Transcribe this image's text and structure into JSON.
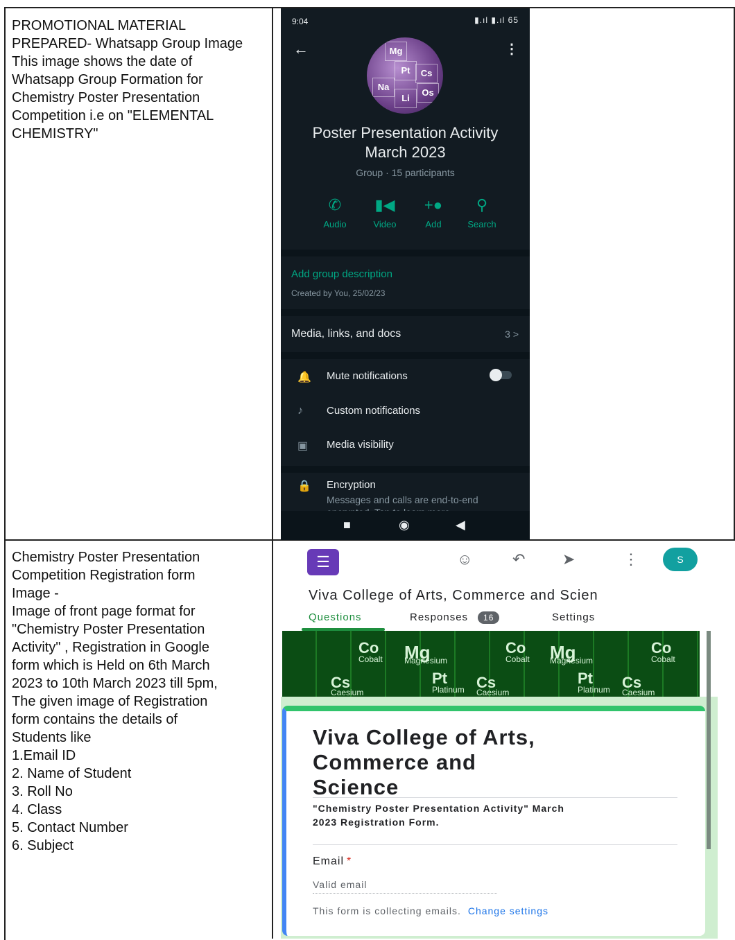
{
  "rows": [
    {
      "description": "PROMOTIONAL MATERIAL\nPREPARED- Whatsapp Group Image\nThis image shows the date of\nWhatsapp Group Formation for\nChemistry Poster Presentation\nCompetition i.e on \"ELEMENTAL\nCHEMISTRY\""
    },
    {
      "description": "Chemistry Poster Presentation\nCompetition Registration form\nImage -\nImage of front page format for\n\"Chemistry Poster Presentation\nActivity\" , Registration in Google\nform which is Held on 6th March\n2023 to 10th March 2023 till 5pm,\nThe given image of Registration\nform contains the details of\nStudents like\n1.Email ID\n2. Name of Student\n3. Roll No\n4. Class\n5. Contact Number\n6. Subject"
    }
  ],
  "whatsapp": {
    "status_time": "9:04",
    "status_right": "▮.ıl ▮.ıl 65",
    "avatar_tiles": [
      "Mg",
      "Pt",
      "Cs",
      "Na",
      "Li",
      "Os"
    ],
    "group_name": "Poster Presentation Activity\nMarch 2023",
    "group_meta": "Group · 15 participants",
    "actions": [
      {
        "label": "Audio",
        "icon": "phone-icon"
      },
      {
        "label": "Video",
        "icon": "video-icon"
      },
      {
        "label": "Add",
        "icon": "add-person-icon"
      },
      {
        "label": "Search",
        "icon": "search-icon"
      }
    ],
    "add_description": "Add group description",
    "created_by": "Created by You, 25/02/23",
    "media_label": "Media, links, and docs",
    "media_count": "3 >",
    "settings": [
      {
        "label": "Mute notifications",
        "icon": "bell-icon"
      },
      {
        "label": "Custom notifications",
        "icon": "music-note-icon"
      },
      {
        "label": "Media visibility",
        "icon": "image-icon"
      },
      {
        "label": "Encryption",
        "icon": "lock-icon"
      }
    ],
    "encryption_sub": "Messages and calls are end-to-end\nencrypted. Tap to learn more.",
    "accent_color": "#00a884"
  },
  "google_form": {
    "header_title": "Viva College of Arts, Commerce and Scien",
    "tabs": {
      "questions": "Questions",
      "responses": "Responses",
      "responses_count": "16",
      "settings": "Settings"
    },
    "avatar_letter": "S",
    "banner_elements": [
      "Co",
      "Mg",
      "Co",
      "Mg",
      "Co",
      "Cs",
      "Pt",
      "Cs",
      "Pt",
      "Cs"
    ],
    "banner_labels": [
      "Cobalt",
      "Magnesium",
      "Cobalt",
      "Magnesium",
      "Cobalt",
      "Caesium",
      "Platinum",
      "Caesium",
      "Platinum",
      "Caesium"
    ],
    "form_title": "Viva College of Arts,\nCommerce and\nScience",
    "form_description": "\"Chemistry Poster Presentation Activity\" March\n2023 Registration Form.",
    "question_label": "Email",
    "question_placeholder": "Valid email",
    "collecting_note": "This form is collecting emails.",
    "change_settings": "Change settings",
    "theme_color": "#673ab7",
    "accent_color": "#1e8e3e"
  }
}
